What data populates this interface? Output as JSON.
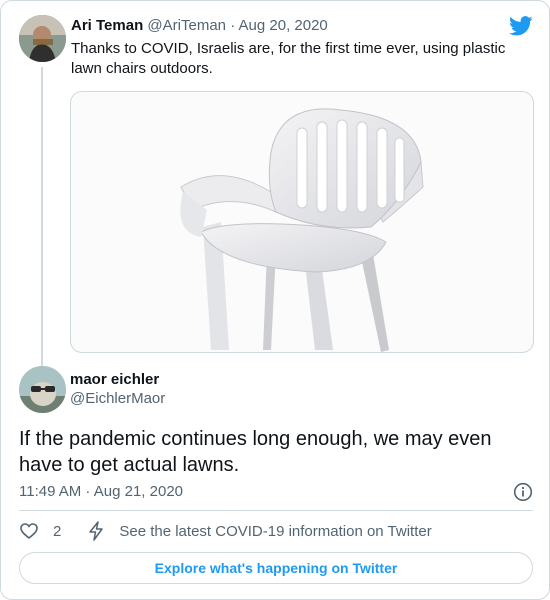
{
  "parent_tweet": {
    "author_name": "Ari Teman",
    "author_handle": "@AriTeman",
    "separator": "·",
    "date": "Aug 20, 2020",
    "text": "Thanks to COVID, Israelis are, for the first time ever, using plastic lawn chairs outdoors.",
    "media_icon": "white-plastic-lawn-chair-photo"
  },
  "main_tweet": {
    "author_name": "maor eichler",
    "author_handle": "@EichlerMaor",
    "text": "If the pandemic continues long enough, we may even have to get actual lawns.",
    "timestamp": "11:49 AM · Aug 21, 2020",
    "like_count": "2",
    "covid_info_text": "See the latest COVID-19 information on Twitter"
  },
  "explore_button": {
    "label": "Explore what's happening on Twitter"
  },
  "colors": {
    "accent": "#1d9bf0",
    "text_primary": "#0f1419",
    "text_secondary": "#536471",
    "border": "#cfd9de"
  },
  "icons": [
    "twitter-bird-icon",
    "info-icon",
    "heart-icon",
    "bolt-icon"
  ]
}
